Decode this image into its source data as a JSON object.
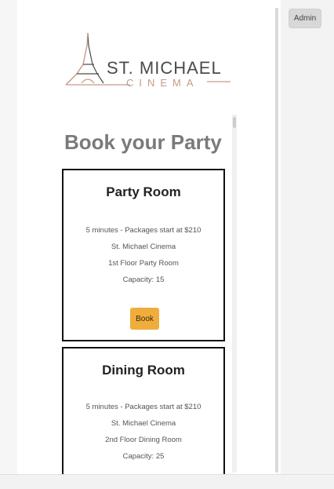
{
  "header": {
    "admin_label": "Admin"
  },
  "logo": {
    "name_line1": "ST. MICHAEL",
    "name_line2": "CINEMA"
  },
  "page": {
    "title": "Book your Party"
  },
  "rooms": [
    {
      "title": "Party Room",
      "package": "5 minutes - Packages start at $210",
      "venue": "St. Michael Cinema",
      "location": "1st Floor Party Room",
      "capacity": "Capacity: 15",
      "book_label": "Book"
    },
    {
      "title": "Dining Room",
      "package": "5 minutes - Packages start at $210",
      "venue": "St. Michael Cinema",
      "location": "2nd Floor Dining Room",
      "capacity": "Capacity: 25"
    }
  ],
  "colors": {
    "accent": "#f0ad3c",
    "title_gray": "#7a7a7a",
    "logo_copper": "#c89a88"
  }
}
